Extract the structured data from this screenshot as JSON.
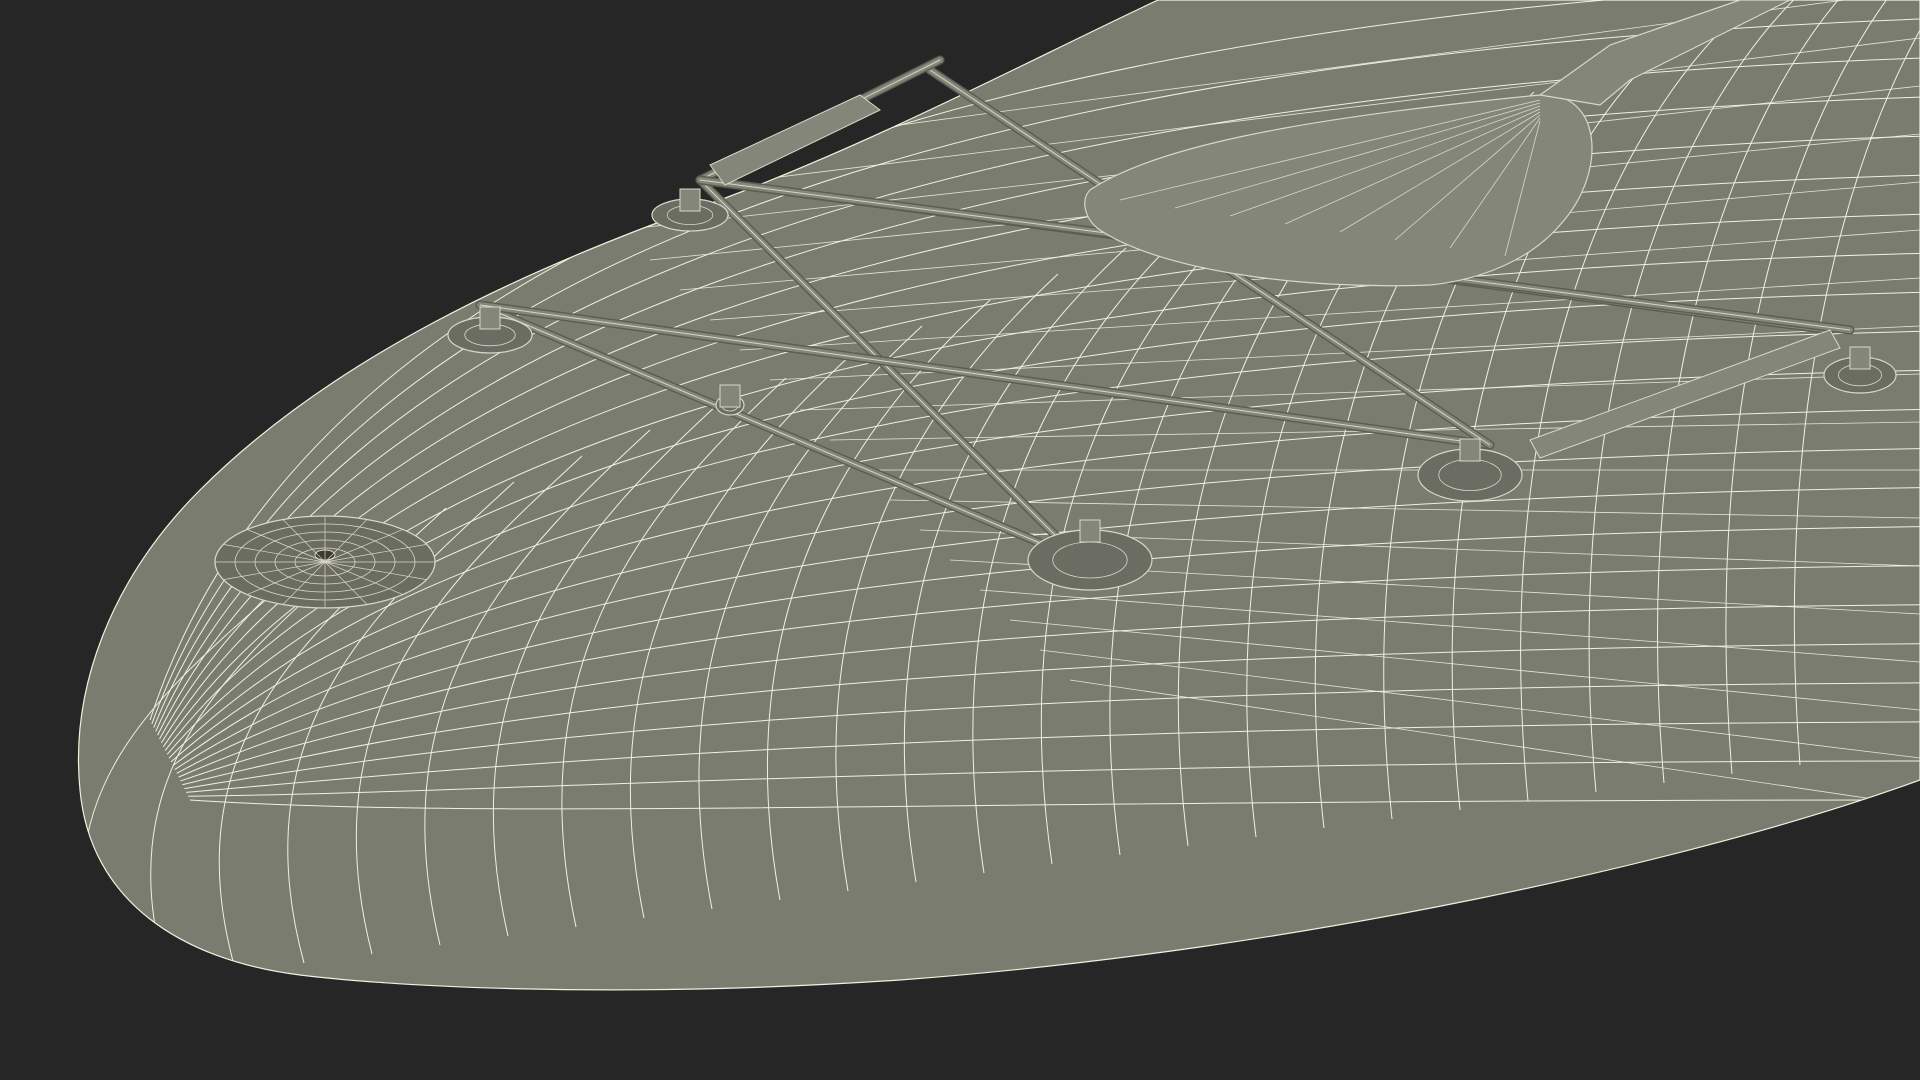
{
  "scene": {
    "subject": "",
    "render_style": "wireframe",
    "colors": {
      "background": "#262626",
      "surface": "#7b7c70",
      "surface_dark": "#6c6d62",
      "wire": "#f2f0df",
      "accessory": "#85867a",
      "accessory_edge": "#d9d7c6"
    }
  }
}
